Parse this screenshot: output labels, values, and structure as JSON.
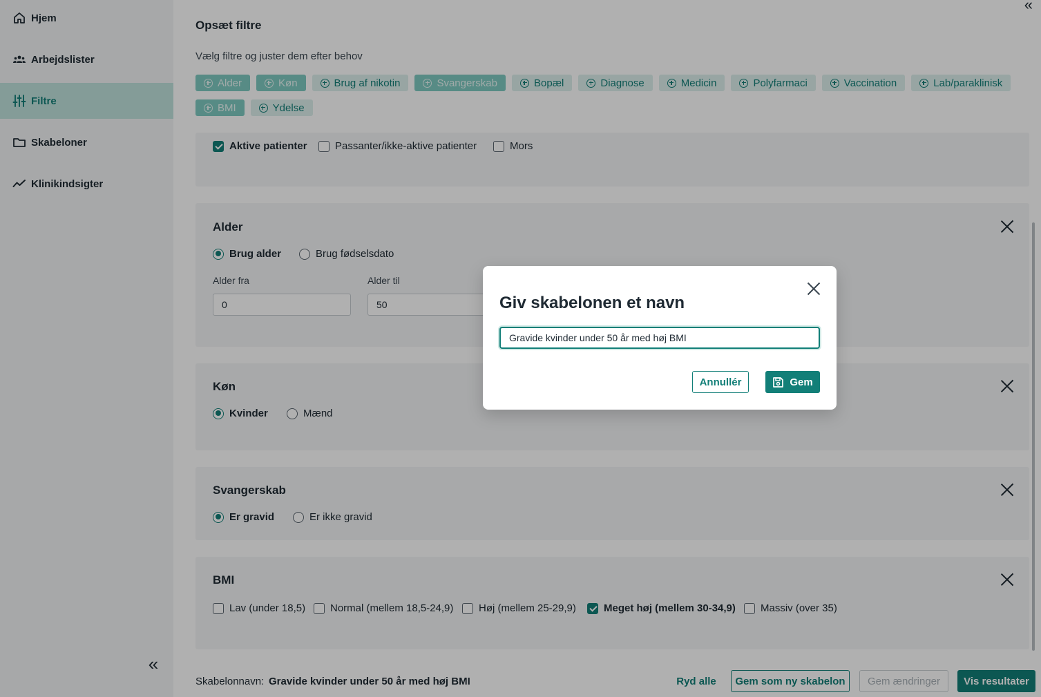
{
  "sidebar": {
    "items": [
      {
        "label": "Hjem",
        "icon": "home-icon"
      },
      {
        "label": "Arbejdslister",
        "icon": "users-icon"
      },
      {
        "label": "Filtre",
        "icon": "sliders-icon",
        "active": true
      },
      {
        "label": "Skabeloner",
        "icon": "folder-icon"
      },
      {
        "label": "Klinikindsigter",
        "icon": "trend-line-icon"
      }
    ],
    "collapse_icon": "«"
  },
  "main": {
    "collapse_icon": "«",
    "title": "Opsæt filtre",
    "subtitle": "Vælg filtre og juster dem efter behov",
    "chips": [
      {
        "label": "Alder",
        "selected": true
      },
      {
        "label": "Køn",
        "selected": true
      },
      {
        "label": "Brug af nikotin",
        "selected": false
      },
      {
        "label": "Svangerskab",
        "selected": true
      },
      {
        "label": "Bopæl",
        "selected": false
      },
      {
        "label": "Diagnose",
        "selected": false
      },
      {
        "label": "Medicin",
        "selected": false
      },
      {
        "label": "Polyfarmaci",
        "selected": false
      },
      {
        "label": "Vaccination",
        "selected": false
      },
      {
        "label": "Lab/paraklinisk",
        "selected": false
      },
      {
        "label": "BMI",
        "selected": true
      },
      {
        "label": "Ydelse",
        "selected": false
      }
    ],
    "patient_status": {
      "options": [
        {
          "label": "Aktive patienter",
          "checked": true
        },
        {
          "label": "Passanter/ikke-aktive patienter",
          "checked": false
        },
        {
          "label": "Mors",
          "checked": false
        }
      ]
    },
    "alder": {
      "title": "Alder",
      "radio": [
        {
          "label": "Brug alder",
          "selected": true
        },
        {
          "label": "Brug fødselsdato",
          "selected": false
        }
      ],
      "from_label": "Alder fra",
      "from_value": "0",
      "to_label": "Alder til",
      "to_value": "50"
    },
    "kon": {
      "title": "Køn",
      "radio": [
        {
          "label": "Kvinder",
          "selected": true
        },
        {
          "label": "Mænd",
          "selected": false
        }
      ]
    },
    "svangerskab": {
      "title": "Svangerskab",
      "radio": [
        {
          "label": "Er gravid",
          "selected": true
        },
        {
          "label": "Er ikke gravid",
          "selected": false
        }
      ]
    },
    "bmi": {
      "title": "BMI",
      "options": [
        {
          "label": "Lav (under 18,5)",
          "checked": false
        },
        {
          "label": "Normal (mellem 18,5-24,9)",
          "checked": false
        },
        {
          "label": "Høj (mellem 25-29,9)",
          "checked": false
        },
        {
          "label": "Meget høj (mellem 30-34,9)",
          "checked": true
        },
        {
          "label": "Massiv (over 35)",
          "checked": false
        }
      ]
    }
  },
  "footer": {
    "template_label": "Skabelonnavn:",
    "template_name": "Gravide kvinder under 50 år med høj BMI",
    "clear_all": "Ryd alle",
    "save_as_new": "Gem som ny skabelon",
    "save_changes": "Gem ændringer",
    "show_results": "Vis resultater"
  },
  "modal": {
    "title": "Giv skabelonen et navn",
    "input_value": "Gravide kvinder under 50 år med høj BMI",
    "cancel_label": "Annullér",
    "save_label": "Gem",
    "save_icon": "floppy-disk-icon"
  },
  "colors": {
    "accent": "#127f78",
    "accent_light": "#dcefec",
    "sidebar_active": "#bfe3dd",
    "card_bg": "#f4f5f6"
  }
}
